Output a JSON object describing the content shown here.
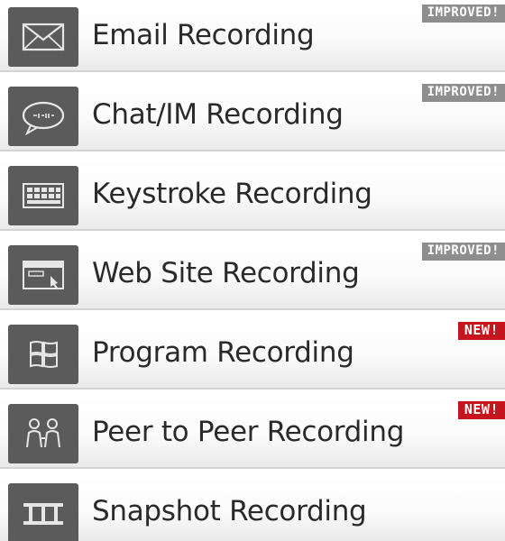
{
  "items": [
    {
      "label": "Email Recording",
      "badge": "IMPROVED!",
      "badge_type": "improved",
      "icon": "envelope-icon"
    },
    {
      "label": "Chat/IM Recording",
      "badge": "IMPROVED!",
      "badge_type": "improved",
      "icon": "chat-bubble-icon"
    },
    {
      "label": "Keystroke Recording",
      "badge": "",
      "badge_type": "",
      "icon": "keyboard-icon"
    },
    {
      "label": "Web Site Recording",
      "badge": "IMPROVED!",
      "badge_type": "improved",
      "icon": "browser-window-icon"
    },
    {
      "label": "Program Recording",
      "badge": "NEW!",
      "badge_type": "new",
      "icon": "windows-logo-icon"
    },
    {
      "label": "Peer to Peer Recording",
      "badge": "NEW!",
      "badge_type": "new",
      "icon": "people-icon"
    },
    {
      "label": "Snapshot Recording",
      "badge": "",
      "badge_type": "",
      "icon": "film-strip-icon"
    }
  ],
  "colors": {
    "icon_background": "#5b5b5b",
    "improved_badge": "#8e8e8e",
    "new_badge": "#c4161c",
    "label_text": "#2a2a2a"
  }
}
